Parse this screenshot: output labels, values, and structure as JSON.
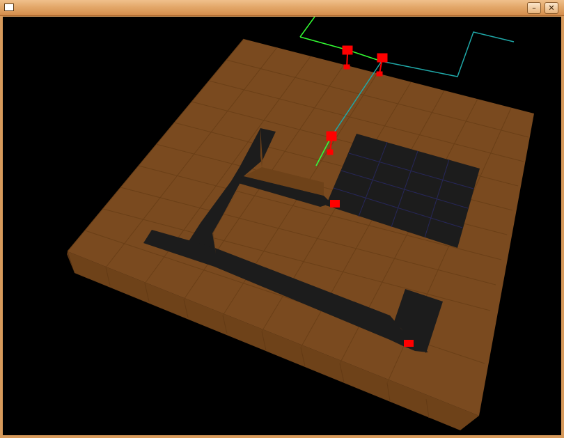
{
  "window": {
    "title": "",
    "minimize_label": "–",
    "close_label": "✕"
  },
  "scene": {
    "background_color": "#000000",
    "floor_color": "#7a4a1f",
    "floor_front_color": "#6e4219",
    "floor_left_color": "#8a5726",
    "floor_grid_color": "#6b4018",
    "pit_color": "#1c1c1c",
    "pit_grid_color": "#27275a",
    "marker_color": "#ff0000",
    "path_green_color": "#33ff33",
    "path_cyan_color": "#1fa8a8"
  }
}
